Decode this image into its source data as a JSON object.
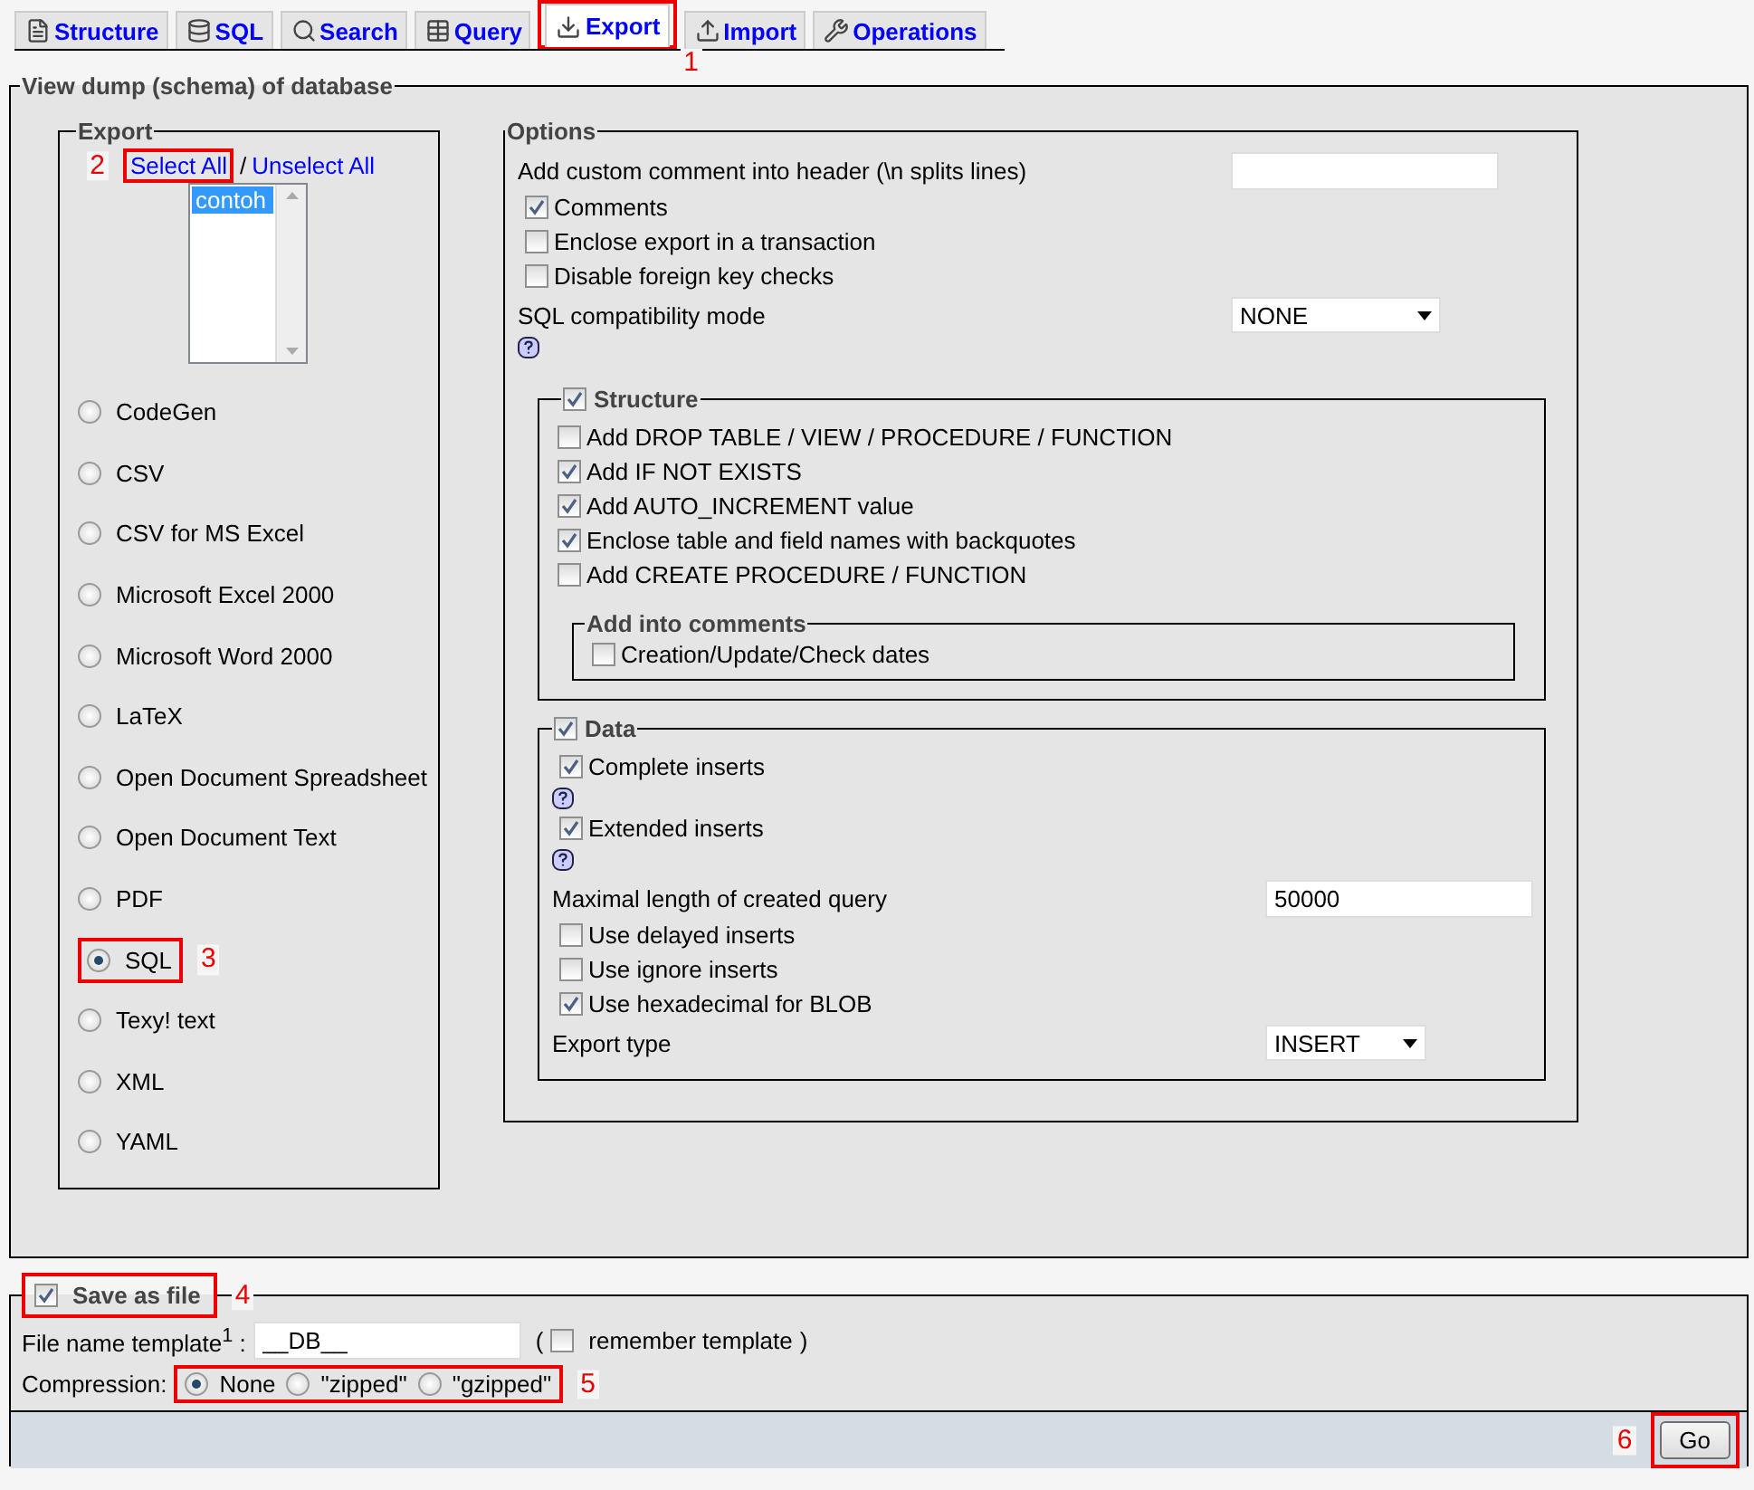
{
  "tabs": [
    {
      "label": "Structure",
      "selected": false
    },
    {
      "label": "SQL",
      "selected": false
    },
    {
      "label": "Search",
      "selected": false
    },
    {
      "label": "Query",
      "selected": false
    },
    {
      "label": "Export",
      "selected": true,
      "annotation": "1"
    },
    {
      "label": "Import",
      "selected": false
    },
    {
      "label": "Operations",
      "selected": false
    }
  ],
  "dump": {
    "legend": "View dump (schema) of database",
    "export": {
      "legend": "Export",
      "select_all": {
        "label": "Select All",
        "annotation": "2"
      },
      "separator": "/",
      "unselect_all": "Unselect All",
      "databases": [
        {
          "name": "contoh",
          "selected": true
        }
      ],
      "formats": [
        {
          "label": "CodeGen",
          "selected": false
        },
        {
          "label": "CSV",
          "selected": false
        },
        {
          "label": "CSV for MS Excel",
          "selected": false
        },
        {
          "label": "Microsoft Excel 2000",
          "selected": false
        },
        {
          "label": "Microsoft Word 2000",
          "selected": false
        },
        {
          "label": "LaTeX",
          "selected": false
        },
        {
          "label": "Open Document Spreadsheet",
          "selected": false
        },
        {
          "label": "Open Document Text",
          "selected": false
        },
        {
          "label": "PDF",
          "selected": false
        },
        {
          "label": "SQL",
          "selected": true,
          "annotation": "3"
        },
        {
          "label": "Texy! text",
          "selected": false
        },
        {
          "label": "XML",
          "selected": false
        },
        {
          "label": "YAML",
          "selected": false
        }
      ]
    },
    "options": {
      "legend": "Options",
      "items": [
        {
          "kind": "input",
          "label": "Add custom comment into header (\\n splits lines)"
        },
        {
          "kind": "checkbox",
          "label": "Comments",
          "checked": true
        },
        {
          "kind": "checkbox",
          "label": "Enclose export in a transaction",
          "checked": false
        },
        {
          "kind": "checkbox",
          "label": "Disable foreign key checks",
          "checked": false
        },
        {
          "kind": "select",
          "label": "SQL compatibility mode",
          "value": "NONE",
          "help": true
        }
      ],
      "structure": {
        "label": "Structure",
        "checked": true,
        "items": [
          {
            "kind": "checkbox",
            "label": "Add DROP TABLE / VIEW / PROCEDURE / FUNCTION",
            "checked": false
          },
          {
            "kind": "checkbox",
            "label": "Add IF NOT EXISTS",
            "checked": true
          },
          {
            "kind": "checkbox",
            "label": "Add AUTO_INCREMENT value",
            "checked": true
          },
          {
            "kind": "checkbox",
            "label": "Enclose table and field names with backquotes",
            "checked": true
          },
          {
            "kind": "checkbox",
            "label": "Add CREATE PROCEDURE / FUNCTION",
            "checked": false
          }
        ],
        "comments": {
          "legend": "Add into comments",
          "items": [
            {
              "kind": "checkbox",
              "label": "Creation/Update/Check dates",
              "checked": false
            }
          ]
        }
      },
      "data": {
        "label": "Data",
        "checked": true,
        "items": [
          {
            "kind": "checkbox",
            "label": "Complete inserts",
            "checked": true,
            "help": true
          },
          {
            "kind": "checkbox",
            "label": "Extended inserts",
            "checked": true,
            "help": true
          },
          {
            "kind": "input",
            "label": "Maximal length of created query",
            "value": "50000"
          },
          {
            "kind": "checkbox",
            "label": "Use delayed inserts",
            "checked": false
          },
          {
            "kind": "checkbox",
            "label": "Use ignore inserts",
            "checked": false
          },
          {
            "kind": "checkbox",
            "label": "Use hexadecimal for BLOB",
            "checked": true
          },
          {
            "kind": "select",
            "label": "Export type",
            "value": "INSERT"
          }
        ]
      }
    }
  },
  "save": {
    "label": "Save as file",
    "checked": true,
    "annotation": "4",
    "template_label": "File name template$^{1}$ :",
    "template_value": "__DB__",
    "open_paren": "(",
    "remember": {
      "label": "remember template",
      "checked": false
    },
    "close_paren": ")",
    "compression_label": "Compression:",
    "compression_annotation": "5",
    "compression": [
      {
        "label": "None",
        "selected": true
      },
      {
        "label": "\"zipped\"",
        "selected": false
      },
      {
        "label": "\"gzipped\"",
        "selected": false
      }
    ]
  },
  "go": {
    "label": "Go",
    "annotation": "6"
  }
}
